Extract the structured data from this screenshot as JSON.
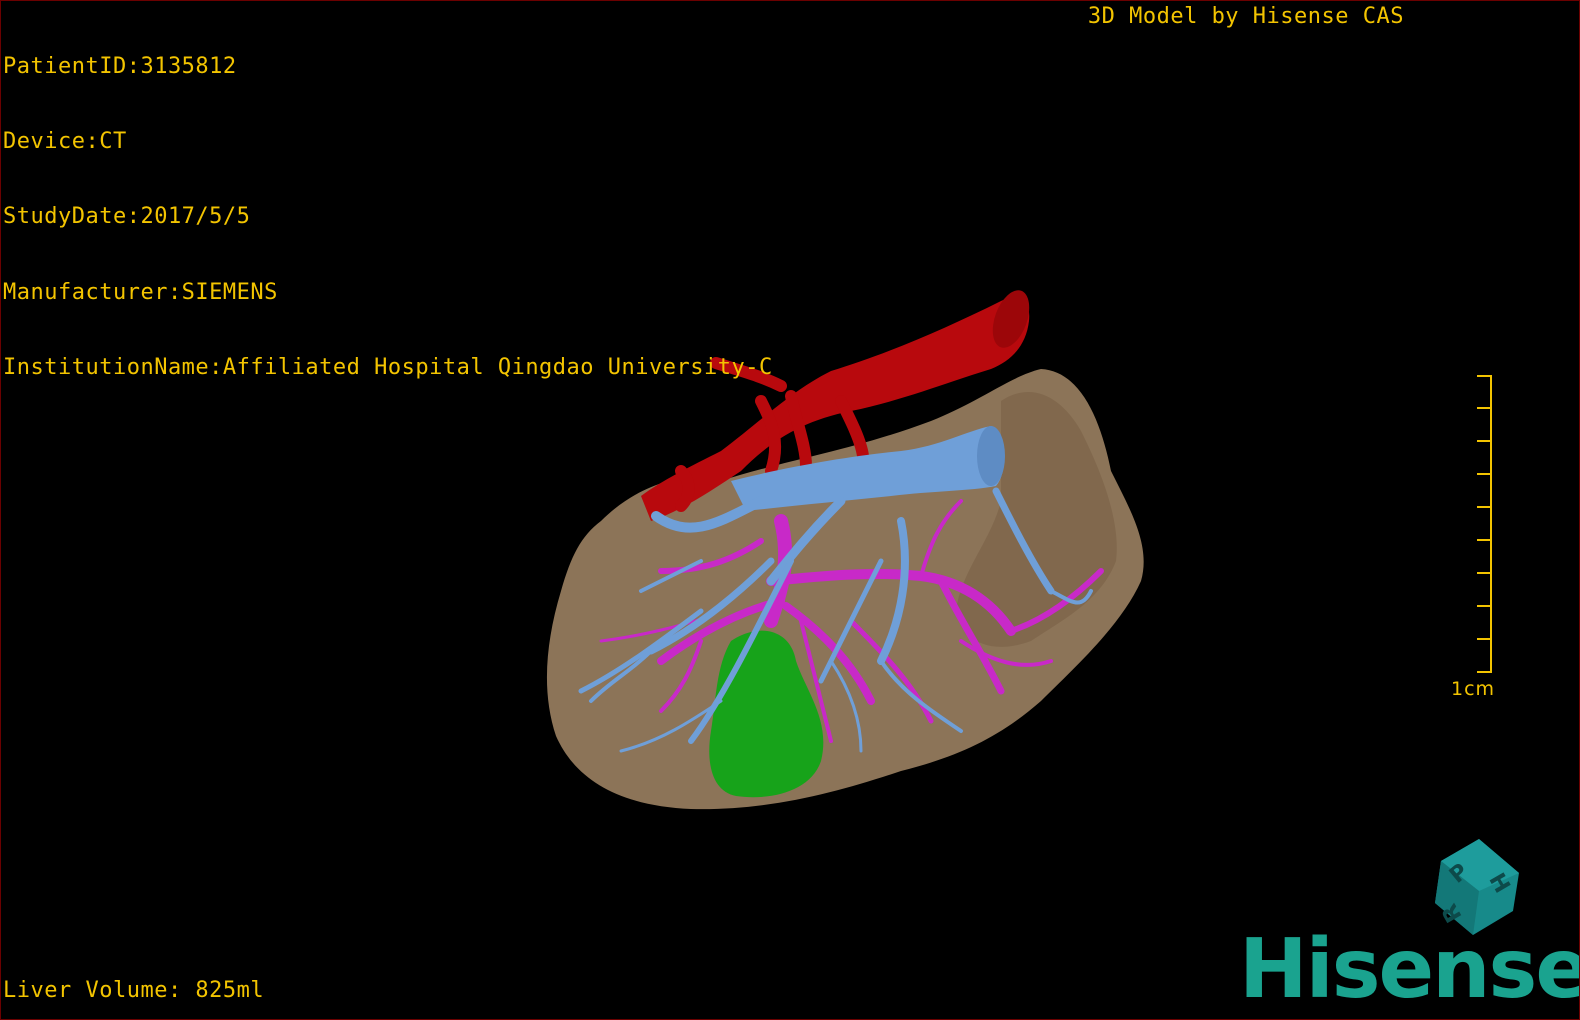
{
  "colors": {
    "overlay_text": "#f3c400",
    "scale_bar": "#f3c400",
    "brand": "#1aa38f",
    "cube_face": "#178a8a",
    "liver": "#8c7458",
    "artery_main": "#b8090d",
    "portal_vein": "#6f9fd8",
    "hepatic_vessel": "#c829c8",
    "gallbladder": "#17a31a",
    "frame_border": "#6b0000"
  },
  "dicom_info": {
    "patient_id": "PatientID:3135812",
    "device": "Device:CT",
    "study_date": "StudyDate:2017/5/5",
    "manufacturer": "Manufacturer:SIEMENS",
    "institution": "InstitutionName:Affiliated Hospital Qingdao University-C"
  },
  "vendor_credit": "3D Model by Hisense CAS",
  "liver_volume": "Liver Volume: 825ml",
  "scale_bar": {
    "label": "1cm"
  },
  "orientation_cube": {
    "faces": [
      "P",
      "H",
      "R"
    ]
  },
  "brand": {
    "logo_text": "Hisense"
  },
  "model": {
    "icon": "3d-liver-model"
  }
}
